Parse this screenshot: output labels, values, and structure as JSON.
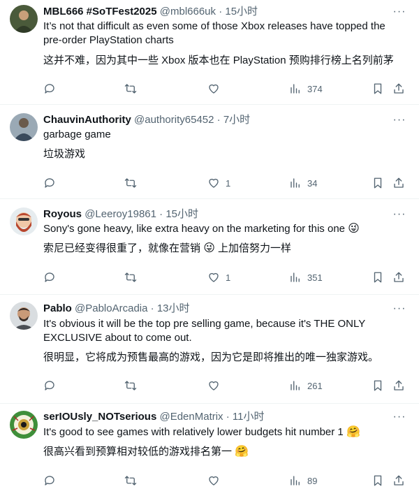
{
  "tweets": [
    {
      "display_name": "MBL666 #SoTFest2025",
      "handle": "@mbl666uk",
      "separator": "·",
      "time": "15小时",
      "text": "It’s not that difficult as even some of those Xbox releases have topped the pre-order PlayStation charts",
      "translation": "这并不难，因为其中一些 Xbox 版本也在 PlayStation 预购排行榜上名列前茅",
      "likes": "",
      "views": "374"
    },
    {
      "display_name": "ChauvinAuthority",
      "handle": "@authority65452",
      "separator": "·",
      "time": "7小时",
      "text": "garbage game",
      "translation": "垃圾游戏",
      "likes": "1",
      "views": "34"
    },
    {
      "display_name": "Royous",
      "handle": "@Leeroy19861",
      "separator": "·",
      "time": "15小时",
      "text": "Sony's gone heavy, like extra heavy on the marketing for this one",
      "text_emoji": "😜",
      "translation": "索尼已经变得很重了，就像在营销",
      "translation_emoji": "😜",
      "translation_tail": "上加倍努力一样",
      "likes": "1",
      "views": "351"
    },
    {
      "display_name": "Pablo",
      "handle": "@PabloArcadia",
      "separator": "·",
      "time": "13小时",
      "text": "It's obvious it will be the top pre selling game, because it's THE ONLY EXCLUSIVE about to come out.",
      "translation": "很明显，它将成为预售最高的游戏，因为它是即将推出的唯一独家游戏。",
      "likes": "",
      "views": "261"
    },
    {
      "display_name": "serIOUsly_NOTserious",
      "handle": "@EdenMatrix",
      "separator": "·",
      "time": "11小时",
      "text": "It's good to see games with relatively lower budgets hit number 1",
      "text_emoji": "🤗",
      "translation": "很高兴看到预算相对较低的游戏排名第一",
      "translation_emoji": "🤗",
      "likes": "",
      "views": "89"
    }
  ],
  "more_icon": "···",
  "colors": {
    "text": "#0f1419",
    "secondary": "#536471",
    "divider": "#eff3f4"
  }
}
